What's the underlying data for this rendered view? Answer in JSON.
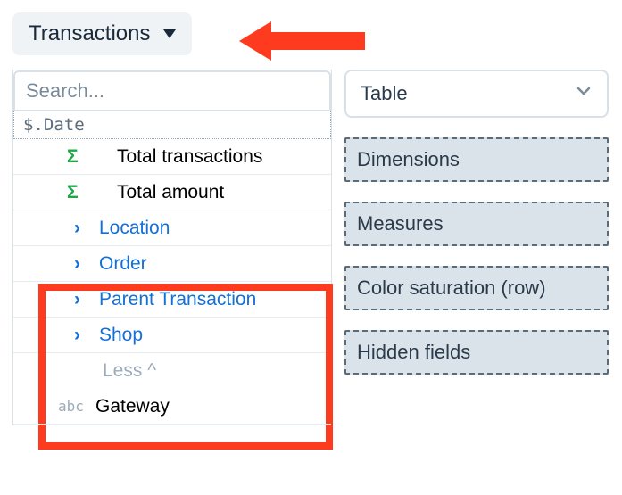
{
  "header": {
    "datasource_label": "Transactions"
  },
  "search": {
    "placeholder": "Search..."
  },
  "date_token": "$.Date",
  "fields": {
    "sigma_items": [
      "Total transactions",
      "Total amount"
    ],
    "fk_items": [
      "Location",
      "Order",
      "Parent Transaction",
      "Shop"
    ],
    "less_label": "Less ^",
    "gateway_label": "Gateway"
  },
  "right": {
    "viz_label": "Table",
    "dropzones": [
      "Dimensions",
      "Measures",
      "Color saturation (row)",
      "Hidden fields"
    ]
  }
}
